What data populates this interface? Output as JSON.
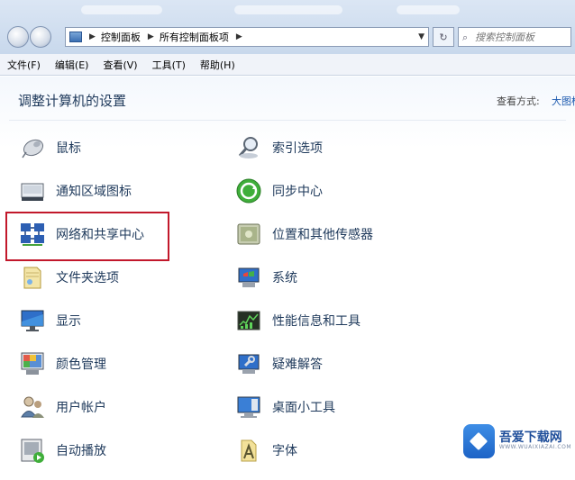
{
  "address_bar": {
    "breadcrumbs": [
      "控制面板",
      "所有控制面板项"
    ],
    "search_placeholder": "搜索控制面板"
  },
  "menu": [
    "文件(F)",
    "编辑(E)",
    "查看(V)",
    "工具(T)",
    "帮助(H)"
  ],
  "main": {
    "heading": "调整计算机的设置",
    "view_by_label": "查看方式:",
    "view_by_value": "大图标",
    "items_left": [
      {
        "label": "鼠标",
        "icon": "mouse-icon"
      },
      {
        "label": "通知区域图标",
        "icon": "notification-area-icon"
      },
      {
        "label": "网络和共享中心",
        "icon": "network-sharing-icon",
        "highlighted": true
      },
      {
        "label": "文件夹选项",
        "icon": "folder-options-icon"
      },
      {
        "label": "显示",
        "icon": "display-icon"
      },
      {
        "label": "颜色管理",
        "icon": "color-management-icon"
      },
      {
        "label": "用户帐户",
        "icon": "user-accounts-icon"
      },
      {
        "label": "自动播放",
        "icon": "autoplay-icon"
      }
    ],
    "items_right": [
      {
        "label": "索引选项",
        "icon": "indexing-options-icon"
      },
      {
        "label": "同步中心",
        "icon": "sync-center-icon"
      },
      {
        "label": "位置和其他传感器",
        "icon": "location-sensors-icon"
      },
      {
        "label": "系统",
        "icon": "system-icon"
      },
      {
        "label": "性能信息和工具",
        "icon": "performance-tools-icon"
      },
      {
        "label": "疑难解答",
        "icon": "troubleshooting-icon"
      },
      {
        "label": "桌面小工具",
        "icon": "desktop-gadgets-icon"
      },
      {
        "label": "字体",
        "icon": "fonts-icon"
      }
    ]
  },
  "watermark": {
    "title": "吾爱下载网",
    "subtitle": "WWW.WUAIXIAZAI.COM"
  },
  "colors": {
    "highlight_border": "#c2182b",
    "link_text": "#1e395b"
  }
}
